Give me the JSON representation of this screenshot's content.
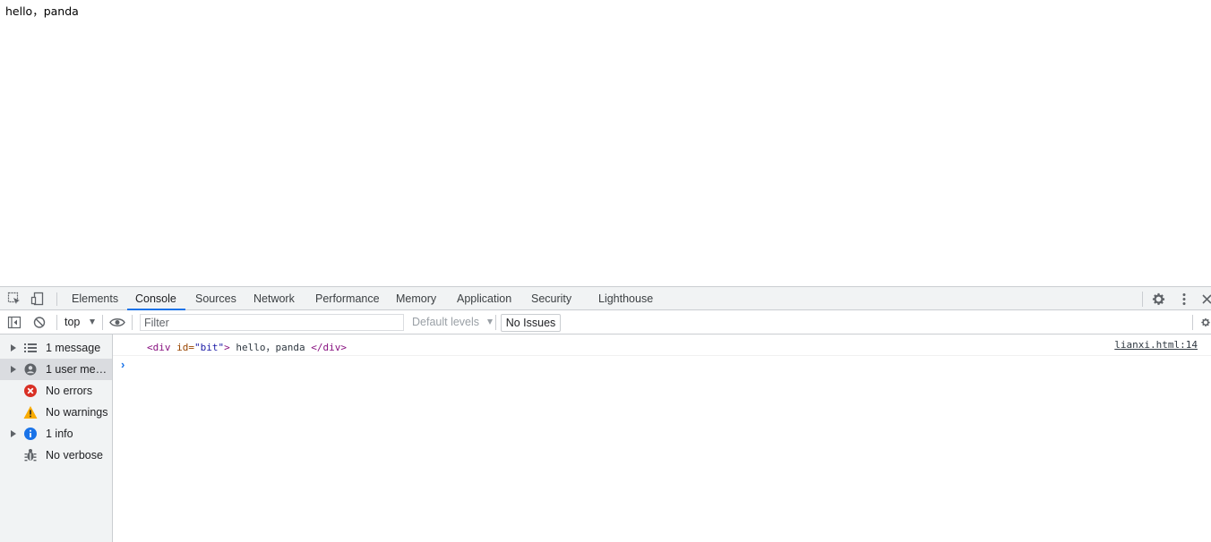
{
  "page": {
    "text": "hello，panda"
  },
  "devtools": {
    "tabs": [
      {
        "label": "Elements"
      },
      {
        "label": "Console"
      },
      {
        "label": "Sources"
      },
      {
        "label": "Network"
      },
      {
        "label": "Performance"
      },
      {
        "label": "Memory"
      },
      {
        "label": "Application"
      },
      {
        "label": "Security"
      },
      {
        "label": "Lighthouse"
      }
    ],
    "active_tab": "Console",
    "toolbar": {
      "context": "top",
      "filter_placeholder": "Filter",
      "levels": "Default levels",
      "issues": "No Issues"
    },
    "sidebar": {
      "items": [
        {
          "label": "1 message",
          "icon": "list-icon"
        },
        {
          "label": "1 user mess...",
          "icon": "user-icon"
        },
        {
          "label": "No errors",
          "icon": "error-icon"
        },
        {
          "label": "No warnings",
          "icon": "warning-icon"
        },
        {
          "label": "1 info",
          "icon": "info-icon"
        },
        {
          "label": "No verbose",
          "icon": "bug-icon"
        }
      ]
    },
    "console": {
      "message": {
        "open_tag_start": "<div",
        "attr_name": " id=",
        "attr_value": "\"bit\"",
        "open_tag_end": ">",
        "text": " hello，panda ",
        "close_tag": "</div>"
      },
      "source": "lianxi.html:14",
      "prompt": "›"
    },
    "colors": {
      "accent": "#1a73e8",
      "error": "#d93025",
      "warning": "#f9ab00",
      "info": "#1a73e8"
    }
  }
}
